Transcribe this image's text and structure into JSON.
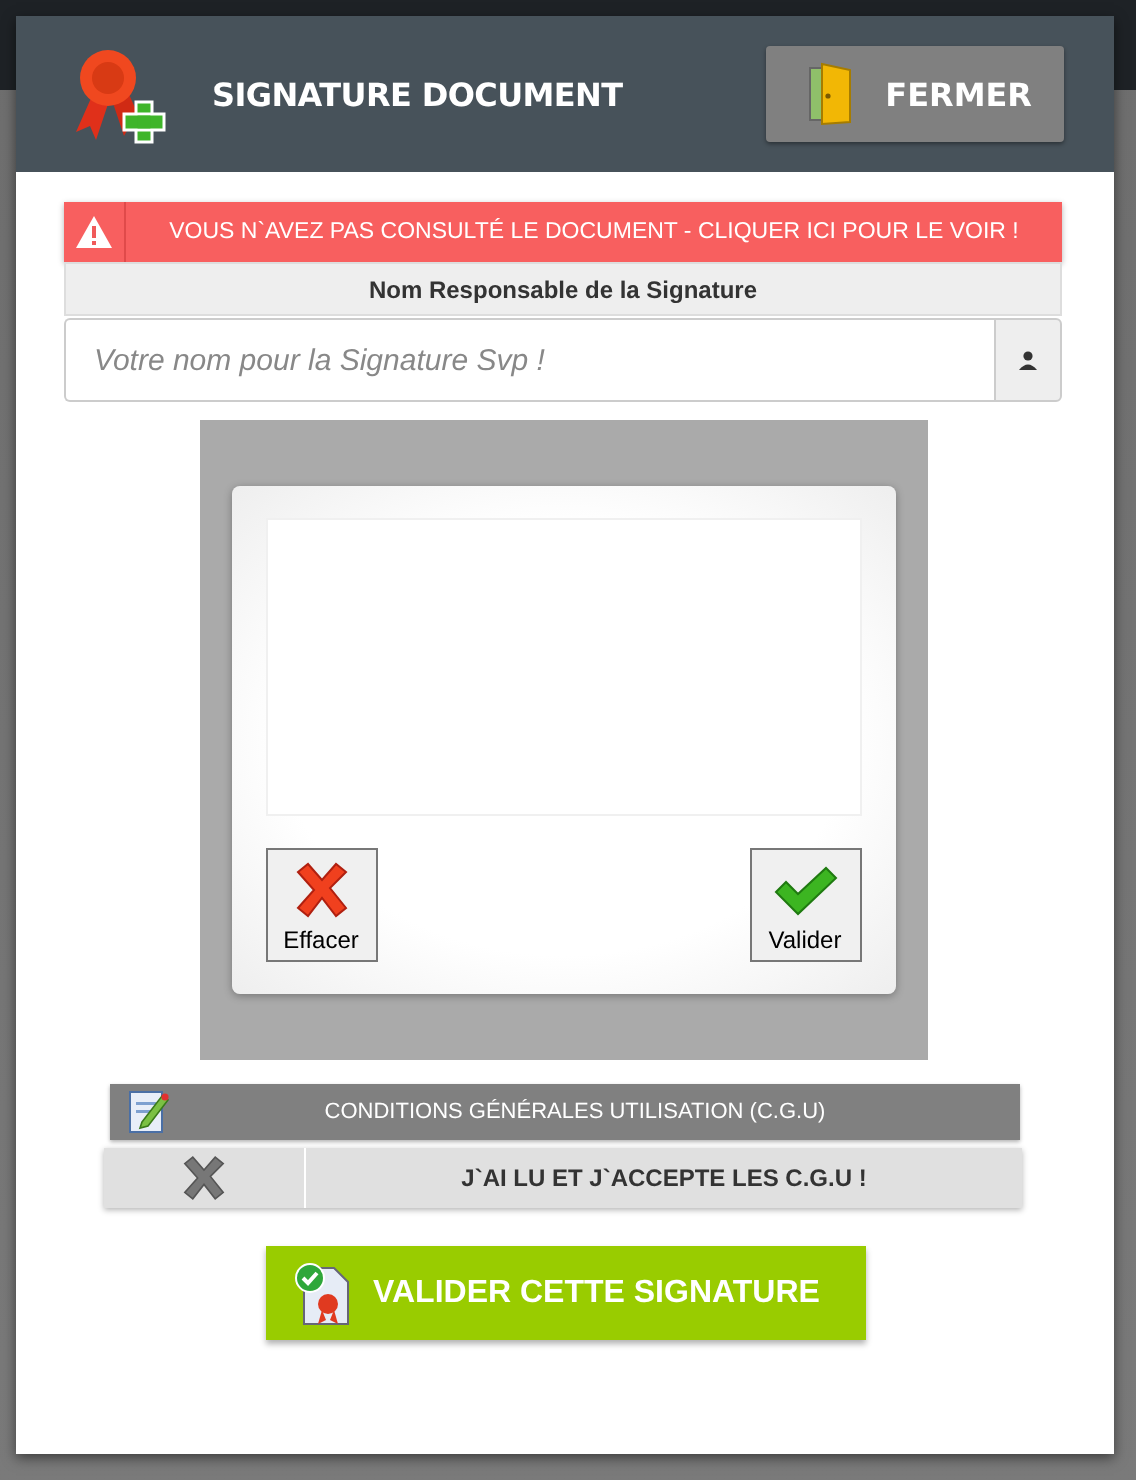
{
  "dialog": {
    "title": "SIGNATURE DOCUMENT",
    "close_button": "FERMER"
  },
  "alert": {
    "text": "VOUS N`AVEZ PAS CONSULTÉ LE DOCUMENT - CLIQUER ICI POUR LE VOIR !"
  },
  "name_field": {
    "label": "Nom Responsable de la Signature",
    "placeholder": "Votre nom pour la Signature Svp !"
  },
  "signature_pad": {
    "buttons": [
      {
        "kind": "clear",
        "label": "Effacer"
      },
      {
        "kind": "confirm",
        "label": "Valider"
      }
    ]
  },
  "terms": {
    "title": "CONDITIONS GÉNÉRALES UTILISATION (C.G.U)",
    "accept_label": "J`AI LU ET J`ACCEPTE LES C.G.U !",
    "checked": false
  },
  "submit_button": "VALIDER CETTE SIGNATURE"
}
